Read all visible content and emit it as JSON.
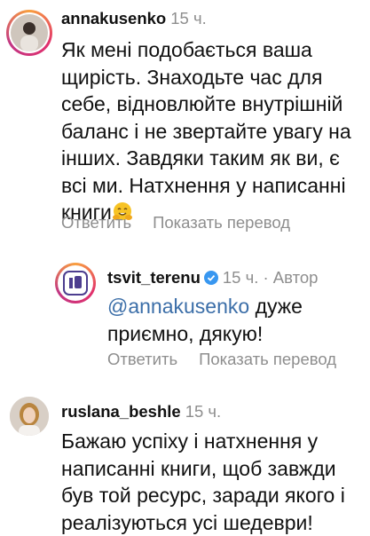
{
  "comments": [
    {
      "username": "annakusenko",
      "time": "15 ч.",
      "lines": [
        "Як мені подобається ваша",
        "щирість. Знаходьте час для",
        "себе, відновлюйте внутрішній",
        "баланс і не звертайте увагу на",
        "інших. Завдяки таким як ви, є",
        "всі ми. Натхнення у написанні",
        "книги"
      ],
      "emoji": "hugging-face-icon",
      "reply_label": "Ответить",
      "translate_label": "Показать перевод"
    },
    {
      "username": "tsvit_terenu",
      "time": "15 ч. · Автор",
      "verified": true,
      "mention": "@annakusenko",
      "line1_rest": " дуже",
      "line2": "приємно, дякую!",
      "reply_label": "Ответить",
      "translate_label": "Показать перевод"
    },
    {
      "username": "ruslana_beshle",
      "time": "15 ч.",
      "lines": [
        "Бажаю успіху і натхнення у",
        "написанні книги, щоб завжди",
        "був той ресурс, заради якого і",
        "реалізуються усі шедеври!"
      ]
    }
  ],
  "colors": {
    "mention": "#3b6ea8",
    "muted": "#8e8e8e",
    "verified": "#3897f0"
  }
}
